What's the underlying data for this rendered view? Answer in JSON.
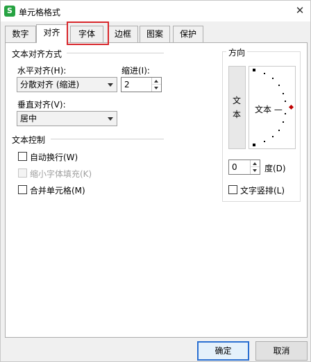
{
  "window": {
    "title": "单元格格式",
    "app_icon_letter": "S",
    "close_glyph": "✕"
  },
  "tabs": [
    {
      "label": "数字"
    },
    {
      "label": "对齐",
      "active": true
    },
    {
      "label": "字体",
      "highlighted": true
    },
    {
      "label": "边框"
    },
    {
      "label": "图案"
    },
    {
      "label": "保护"
    }
  ],
  "alignment": {
    "section_title": "文本对齐方式",
    "horizontal_label": "水平对齐(H):",
    "horizontal_value": "分散对齐 (缩进)",
    "indent_label": "缩进(I):",
    "indent_value": "2",
    "vertical_label": "垂直对齐(V):",
    "vertical_value": "居中"
  },
  "text_control": {
    "section_title": "文本控制",
    "wrap_label": "自动换行(W)",
    "wrap_checked": false,
    "shrink_label": "缩小字体填充(K)",
    "shrink_disabled": true,
    "merge_label": "合并单元格(M)",
    "merge_checked": false
  },
  "orientation": {
    "title": "方向",
    "vertical_text_chars": [
      "文",
      "本"
    ],
    "dial_text": "文本 —",
    "degree_value": "0",
    "degree_label": "度(D)",
    "vertical_stack_label": "文字竖排(L)",
    "vertical_stack_checked": false
  },
  "footer": {
    "ok_label": "确定",
    "cancel_label": "取消"
  },
  "colors": {
    "highlight": "#d8252a",
    "primary_border": "#2a6fd1",
    "app_green": "#27a342",
    "indicator": "#c00000"
  }
}
